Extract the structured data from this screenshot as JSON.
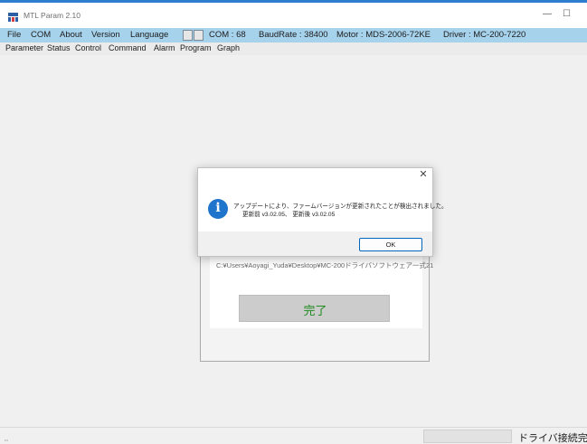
{
  "window": {
    "title": "MTL Param 2.10",
    "minimize_glyph": "—",
    "maximize_glyph": "☐"
  },
  "menu_top": {
    "items": [
      "File",
      "COM",
      "About",
      "Version",
      "Language"
    ],
    "com_info": "COM : 68",
    "baud_info": "BaudRate : 38400",
    "motor_info": "Motor : MDS-2006-72KE",
    "driver_info": "Driver : MC-200-7220"
  },
  "menu_sub": {
    "items": [
      "Parameter",
      "Status",
      "Control",
      "Command",
      "Alarm",
      "Program",
      "Graph"
    ]
  },
  "background_window": {
    "path": "C:¥Users¥Aoyagi_Yuda¥Desktop¥MC-200ドライバソフトウェア一式21",
    "done_label": "完了"
  },
  "dialog": {
    "close_glyph": "✕",
    "message_line1": "アップデートにより、ファームバージョンが更新されたことが検出されました。",
    "message_line2": "更新前 v3.02.05、 更新後 v3.02.05",
    "ok_label": "OK"
  },
  "statusbar": {
    "grip_glyph": "⣀",
    "status_text": "ドライバ接続完了"
  },
  "colors": {
    "menubar_accent": "#a6d2ec",
    "top_line": "#2f7fd0",
    "info_icon": "#1f74cc",
    "done_text": "#1f8a1f"
  },
  "icons": {
    "app": "app-logo-icon",
    "info": "info-icon",
    "close": "close-icon"
  }
}
